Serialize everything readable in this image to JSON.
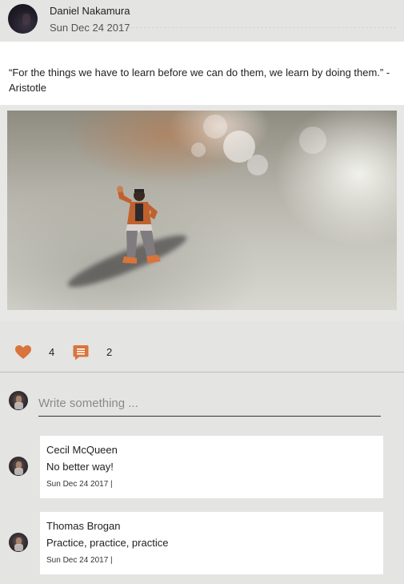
{
  "post": {
    "author": "Daniel Nakamura",
    "date": "Sun Dec 24 2017",
    "quote": "“For the things we have to learn before we can do them, we learn by doing them.” - Aristotle"
  },
  "stats": {
    "likes": "4",
    "comments": "2"
  },
  "compose": {
    "placeholder": "Write something ..."
  },
  "comments": [
    {
      "author": "Cecil McQueen",
      "text": "No better way!",
      "meta": "Sun Dec 24 2017 |"
    },
    {
      "author": "Thomas Brogan",
      "text": "Practice, practice, practice",
      "meta": "Sun Dec 24 2017 |"
    }
  ],
  "colors": {
    "accent": "#d9743c",
    "background": "#e4e4e2",
    "card": "#ffffff"
  },
  "icons": [
    "heart-icon",
    "comment-icon"
  ]
}
